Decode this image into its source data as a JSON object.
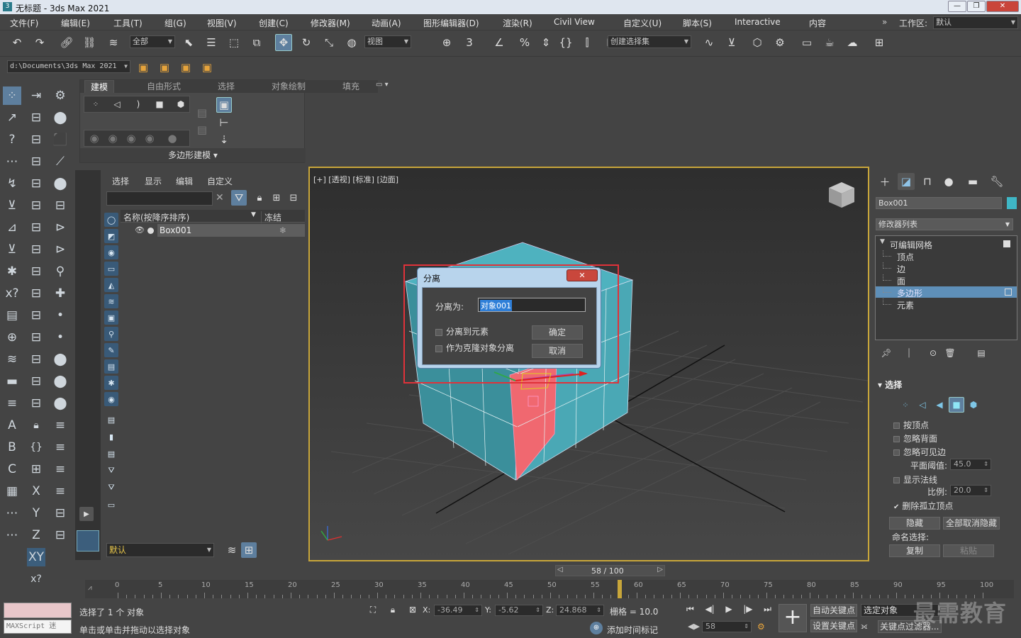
{
  "app": {
    "title": "无标题 - 3ds Max 2021",
    "workspace_label": "工作区:",
    "workspace_value": "默认"
  },
  "menu": [
    "文件(F)",
    "编辑(E)",
    "工具(T)",
    "组(G)",
    "视图(V)",
    "创建(C)",
    "修改器(M)",
    "动画(A)",
    "图形编辑器(D)",
    "渲染(R)",
    "Civil View",
    "自定义(U)",
    "脚本(S)",
    "Interactive",
    "内容"
  ],
  "toolbar": {
    "filter_value": "全部",
    "ref_coord_value": "视图",
    "named_sel_value": "创建选择集",
    "path_value": "d:\\Documents\\3ds Max 2021",
    "icons": [
      "undo-icon",
      "redo-icon",
      "link-icon",
      "unlink-icon",
      "bind-space-warp-icon",
      "select-icon",
      "select-by-name-icon",
      "rect-region-icon",
      "window-crossing-icon",
      "move-icon",
      "rotate-icon",
      "scale-icon",
      "placement-icon",
      "pivot-icon",
      "snap-3-icon",
      "angle-snap-icon",
      "percent-snap-icon",
      "spinner-snap-icon",
      "edit-named-sel-icon",
      "mirror-icon",
      "align-icon",
      "toggle-scene-explorer-icon",
      "toggle-layer-explorer-icon",
      "toggle-ribbon-icon",
      "curve-editor-icon",
      "dope-sheet-icon",
      "material-editor-icon",
      "render-setup-icon",
      "rendered-frame-icon",
      "render-icon",
      "render-cloud-icon",
      "render-iterative-icon"
    ]
  },
  "ribbon": {
    "tabs": [
      "建模",
      "自由形式",
      "选择",
      "对象绘制",
      "填充"
    ],
    "active_tab": "建模",
    "panel_label": "多边形建模"
  },
  "scene_explorer": {
    "tabs": [
      "选择",
      "显示",
      "编辑",
      "自定义"
    ],
    "col_name": "名称(按降序排序)",
    "col_freeze": "冻结",
    "objects": [
      "Box001"
    ],
    "layer_value": "默认"
  },
  "viewport": {
    "label": "[+] [透视] [标准] [边面]"
  },
  "dialog": {
    "title": "分离",
    "detach_as_label": "分离为:",
    "name_value": "对象001",
    "option1": "分离到元素",
    "option2": "作为克隆对象分离",
    "ok": "确定",
    "cancel": "取消"
  },
  "command_panel": {
    "object_name": "Box001",
    "modifier_list": "修改器列表",
    "stack": [
      {
        "label": "可编辑网格",
        "level": 0
      },
      {
        "label": "顶点",
        "level": 1
      },
      {
        "label": "边",
        "level": 1
      },
      {
        "label": "面",
        "level": 1
      },
      {
        "label": "多边形",
        "level": 1,
        "selected": true
      },
      {
        "label": "元素",
        "level": 1
      }
    ],
    "rollout_title": "选择",
    "by_vertex": "按顶点",
    "ignore_back": "忽略背面",
    "ignore_visible": "忽略可见边",
    "planar_label": "平面阈值:",
    "planar_value": "45.0",
    "show_normals": "显示法线",
    "scale_label": "比例:",
    "scale_value": "20.0",
    "delete_isolated": "删除孤立顶点",
    "hide": "隐藏",
    "unhide_all": "全部取消隐藏",
    "named_sel_label": "命名选择:",
    "copy": "复制",
    "paste": "粘贴"
  },
  "timeline": {
    "frame_display": "58 / 100",
    "ticks": [
      "0",
      "5",
      "10",
      "15",
      "20",
      "25",
      "30",
      "35",
      "40",
      "45",
      "50",
      "55",
      "60",
      "65",
      "70",
      "75",
      "80",
      "85",
      "90",
      "95",
      "100"
    ],
    "current_frame": 58
  },
  "status": {
    "selected_text": "选择了 1 个 对象",
    "prompt_text": "单击或单击并拖动以选择对象",
    "maxscript_label": "MAXScript 迷",
    "x_value": "-36.49",
    "y_value": "-5.62",
    "z_value": "24.868",
    "grid_label": "栅格 = 10.0",
    "add_time_tag": "添加时间标记",
    "auto_key": "自动关键点",
    "set_key": "设置关键点",
    "selected_obj": "选定对象",
    "key_filters": "关键点过滤器...",
    "frame_spinner": "58",
    "watermark": "最需教育"
  },
  "colors": {
    "accent": "#5e8fb8",
    "selection_red": "#e0323a",
    "box_teal": "#3f9fae",
    "box_selected": "#f06870"
  }
}
